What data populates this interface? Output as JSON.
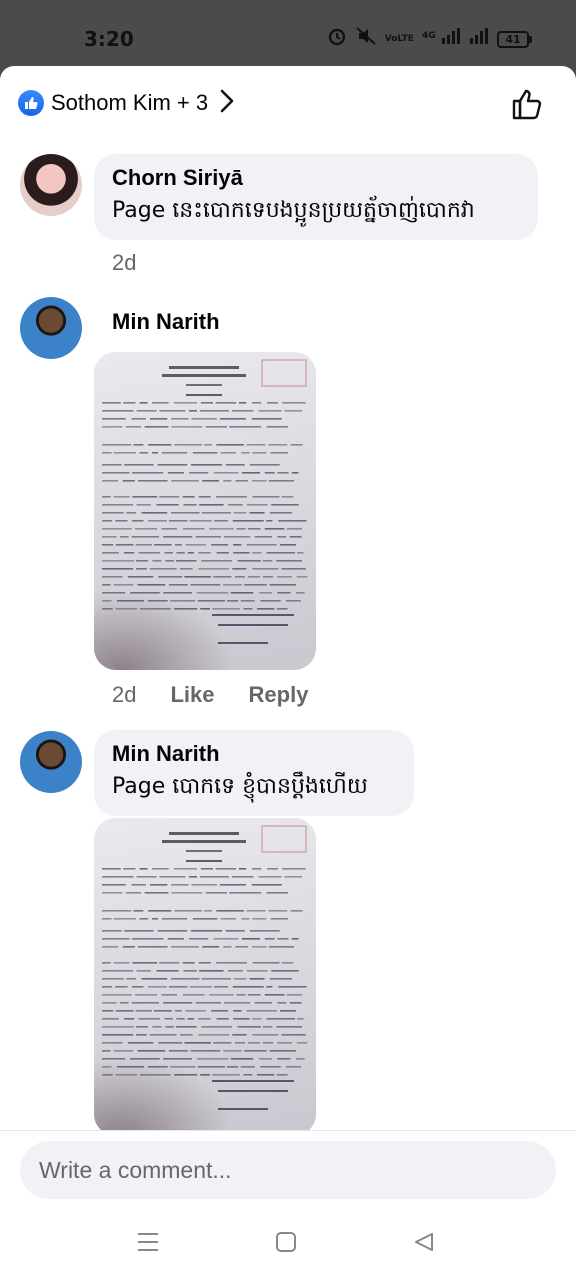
{
  "status_bar": {
    "time": "3:20",
    "network_label": "VoLTE",
    "net_type": "4G",
    "battery": "41"
  },
  "reactions": {
    "names": "Sothom Kim + 3"
  },
  "comments": [
    {
      "author": "Chorn Siriyā",
      "text": "Page នេះបោកទេបងប្អូនប្រយត្ន័ចាញ់បោកវា",
      "time": "2d"
    },
    {
      "author": "Min Narith",
      "text": "",
      "time": "2d",
      "like_label": "Like",
      "reply_label": "Reply",
      "has_image": true
    },
    {
      "author": "Min Narith",
      "text": "Page បោកទេ ខ្ញុំបានប្ដឹងហើយ",
      "has_image": true
    }
  ],
  "composer": {
    "placeholder": "Write a comment..."
  },
  "icons": {
    "reaction": "like-reaction-icon",
    "chevron": "chevron-right-icon",
    "thumb": "thumbs-up-icon",
    "nav_menu": "menu-icon",
    "nav_home": "home-icon",
    "nav_back": "back-icon"
  },
  "colors": {
    "accent": "#1877f2",
    "bubble": "#f0f2f5",
    "meta": "#65676b"
  }
}
